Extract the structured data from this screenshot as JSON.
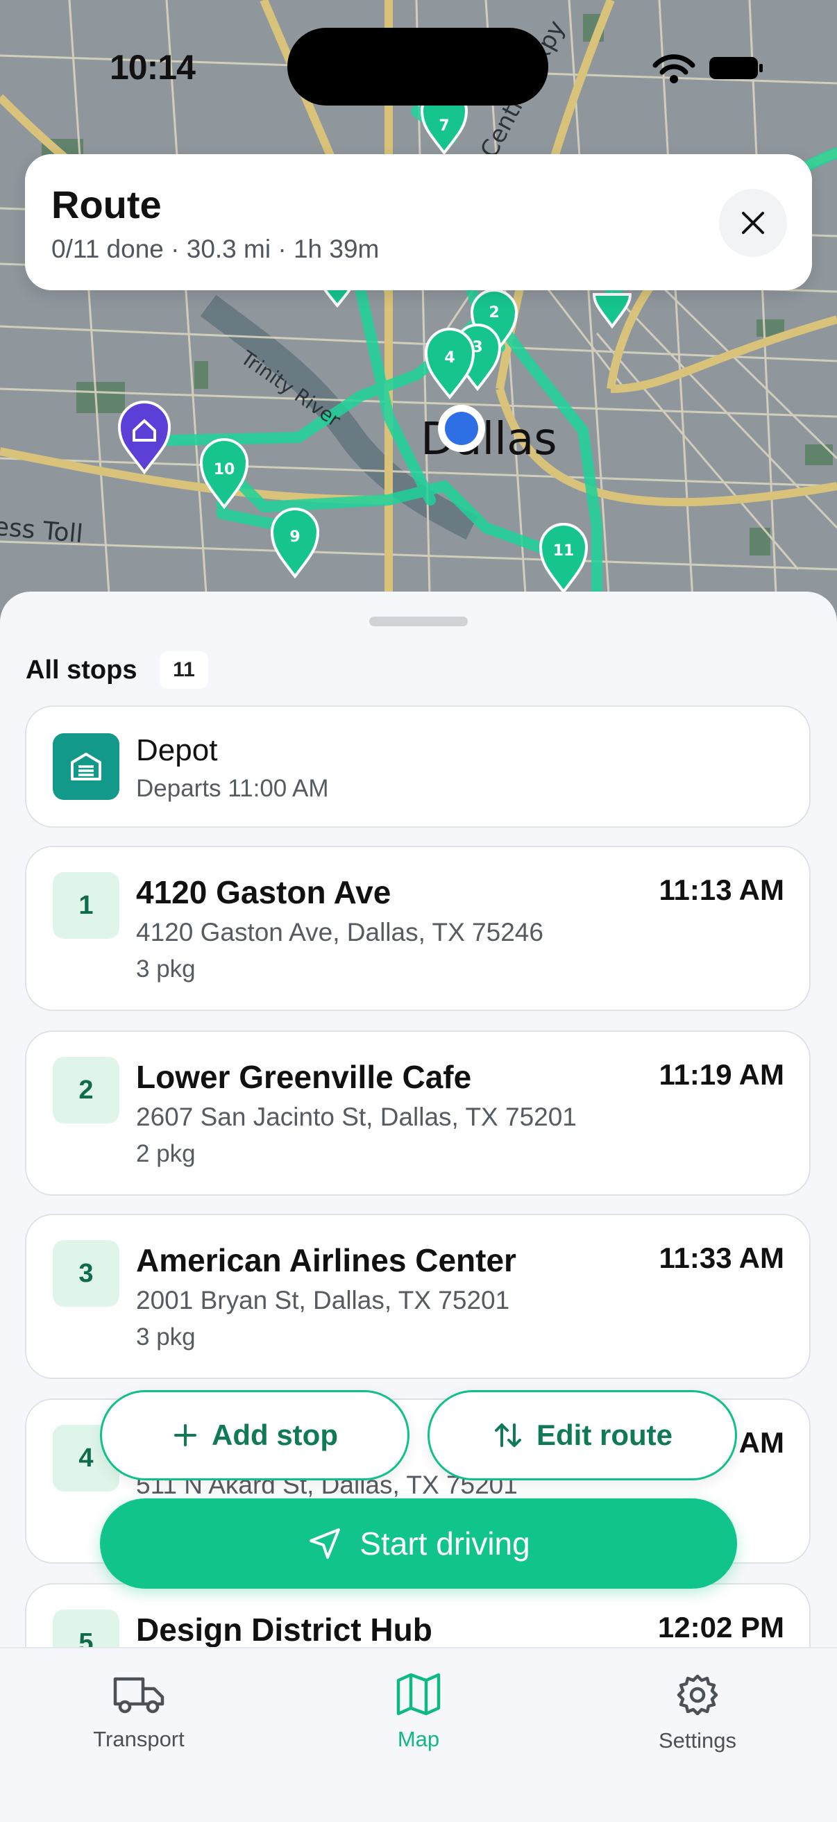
{
  "status_bar": {
    "time": "10:14"
  },
  "map": {
    "city_label": "Dallas",
    "labels": [
      "Trinity River",
      "Central Expy",
      "ess Toll"
    ],
    "markers": [
      "7",
      "2",
      "3",
      "4",
      "10",
      "9",
      "11"
    ],
    "route_color": "#1fd39a",
    "depot_marker_color": "#5b3fd6"
  },
  "route": {
    "title": "Route",
    "summary": "0/11 done · 30.3 mi · 1h 39m"
  },
  "list": {
    "title": "All stops",
    "count": "11",
    "depot": {
      "name": "Depot",
      "departs": "Departs 11:00 AM"
    },
    "stops": [
      {
        "num": "1",
        "name": "4120 Gaston Ave",
        "address": "4120 Gaston Ave, Dallas, TX 75246",
        "packages": "3 pkg",
        "time": "11:13 AM"
      },
      {
        "num": "2",
        "name": "Lower Greenville Cafe",
        "address": "2607 San Jacinto St, Dallas, TX 75201",
        "packages": "2 pkg",
        "time": "11:19 AM"
      },
      {
        "num": "3",
        "name": "American Airlines Center",
        "address": "2001 Bryan St, Dallas, TX 75201",
        "packages": "3 pkg",
        "time": "11:33 AM"
      },
      {
        "num": "4",
        "name": "",
        "address": "511 N Akard St, Dallas, TX 75201",
        "packages": "",
        "time": "AM"
      },
      {
        "num": "5",
        "name": "Design District Hub",
        "address": "",
        "packages": "",
        "time": "12:02 PM"
      }
    ]
  },
  "actions": {
    "add_stop": "Add stop",
    "edit_route": "Edit route",
    "start_driving": "Start driving"
  },
  "tabs": [
    {
      "label": "Transport"
    },
    {
      "label": "Map"
    },
    {
      "label": "Settings"
    }
  ],
  "colors": {
    "accent": "#10c48c",
    "depot": "#12998a"
  }
}
